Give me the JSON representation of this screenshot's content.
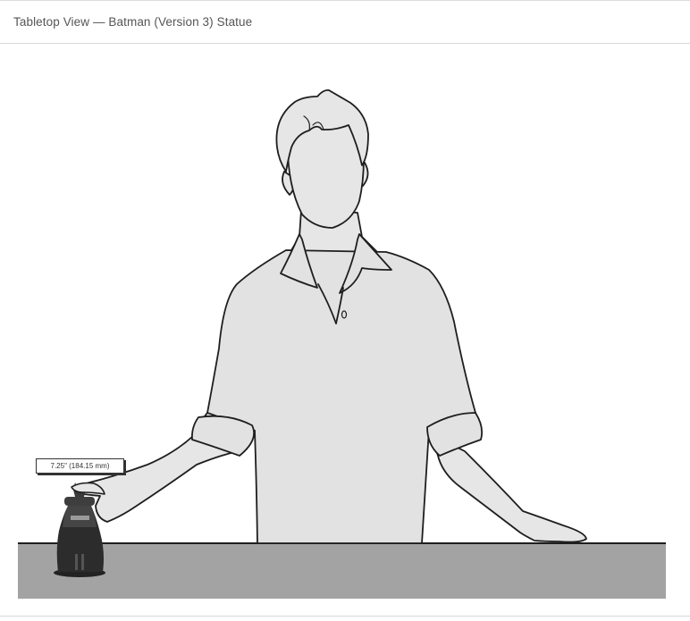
{
  "header": {
    "title": "Tabletop View — Batman (Version 3) Statue"
  },
  "scene": {
    "figure_icon": "person-silhouette",
    "statue_icon": "batman-statue",
    "height_label": "7.25\" (184.15 mm)",
    "colors": {
      "table": "#a3a3a3",
      "shirt": "#e2e2e2",
      "skin": "#e6e6e6",
      "outline": "#1e1e1e",
      "statue": "#2c2c2c"
    }
  }
}
